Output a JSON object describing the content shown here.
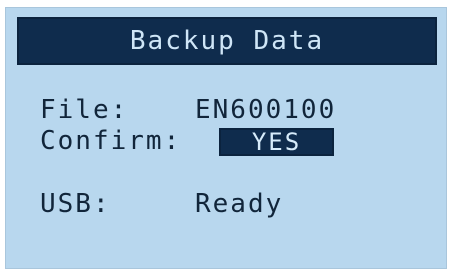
{
  "screen": {
    "title": "Backup Data",
    "fields": {
      "file": {
        "label": "File:",
        "value": "EN600100"
      },
      "confirm": {
        "label": "Confirm:",
        "value": "YES"
      },
      "usb": {
        "label": "USB:",
        "value": "Ready"
      }
    }
  },
  "colors": {
    "panel_background": "#b8d7ee",
    "title_bar": "#0f2c4d",
    "text_dark": "#11253a",
    "text_light": "#cfe6f7"
  }
}
